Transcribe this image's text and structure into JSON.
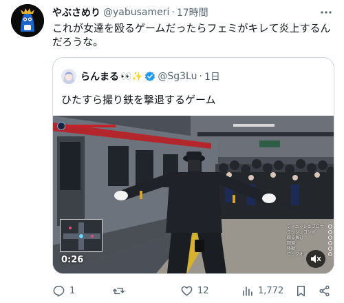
{
  "author": {
    "name": "やぶさめり",
    "handle": "@yabusameri",
    "time": "17時間"
  },
  "post": {
    "text": "これが女達を殴るゲームだったらフェミがキレて炎上するんだろうな。"
  },
  "quote": {
    "name": "らんまる",
    "emoji": "👀✨",
    "handle": "@Sg3Lu",
    "time": "1日",
    "text": "ひたすら撮り鉄を撃退するゲーム",
    "video": {
      "duration": "0:26",
      "hud_items": [
        "フィニッシュブロウ",
        "ラッシュコンボ",
        "殴る掴む",
        "回避",
        "移動",
        "ロックオン"
      ]
    }
  },
  "actions": {
    "replies": "1",
    "reposts": "",
    "likes": "12",
    "views": "1,772"
  },
  "icons": {
    "more": "more-icon",
    "verified": "verified-badge-icon",
    "reply": "reply-icon",
    "repost": "repost-icon",
    "like": "heart-icon",
    "views": "views-icon",
    "bookmark": "bookmark-icon",
    "share": "share-icon",
    "mute": "mute-icon"
  },
  "colors": {
    "text": "#0f1419",
    "secondary": "#536471",
    "border": "#cfd9de",
    "verified": "#1d9bf0",
    "avatar_accent": "#1d64c8",
    "health": "#c6202a"
  }
}
